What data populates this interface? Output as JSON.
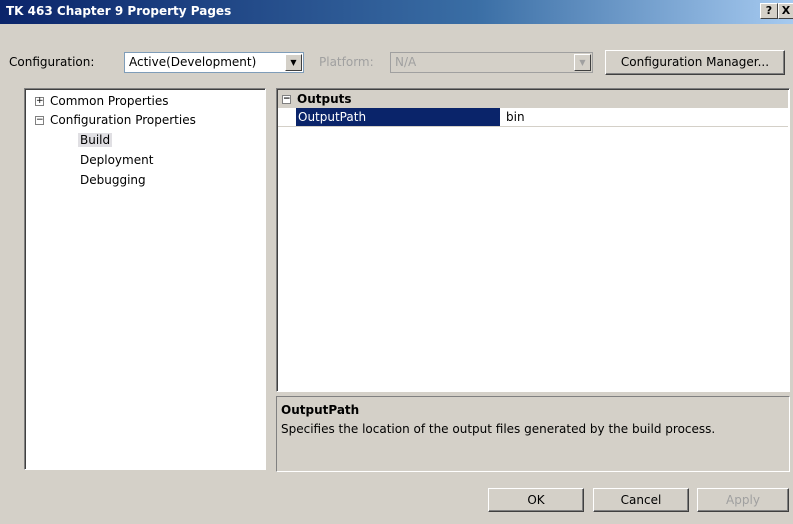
{
  "window": {
    "title": "TK 463 Chapter 9 Property Pages",
    "help_label": "?",
    "close_label": "X"
  },
  "toolbar": {
    "configuration_label": "Configuration:",
    "configuration_value": "Active(Development)",
    "platform_label": "Platform:",
    "platform_value": "N/A",
    "configuration_manager_label": "Configuration Manager..."
  },
  "tree": {
    "common_properties": "Common Properties",
    "configuration_properties": "Configuration Properties",
    "build": "Build",
    "deployment": "Deployment",
    "debugging": "Debugging",
    "expand_glyph": "+",
    "collapse_glyph": "−"
  },
  "grid": {
    "category_glyph": "−",
    "category": "Outputs",
    "property_name": "OutputPath",
    "property_value": "bin"
  },
  "description": {
    "title": "OutputPath",
    "text": "Specifies the location of the output files generated by the build process."
  },
  "buttons": {
    "ok": "OK",
    "cancel": "Cancel",
    "apply": "Apply"
  }
}
